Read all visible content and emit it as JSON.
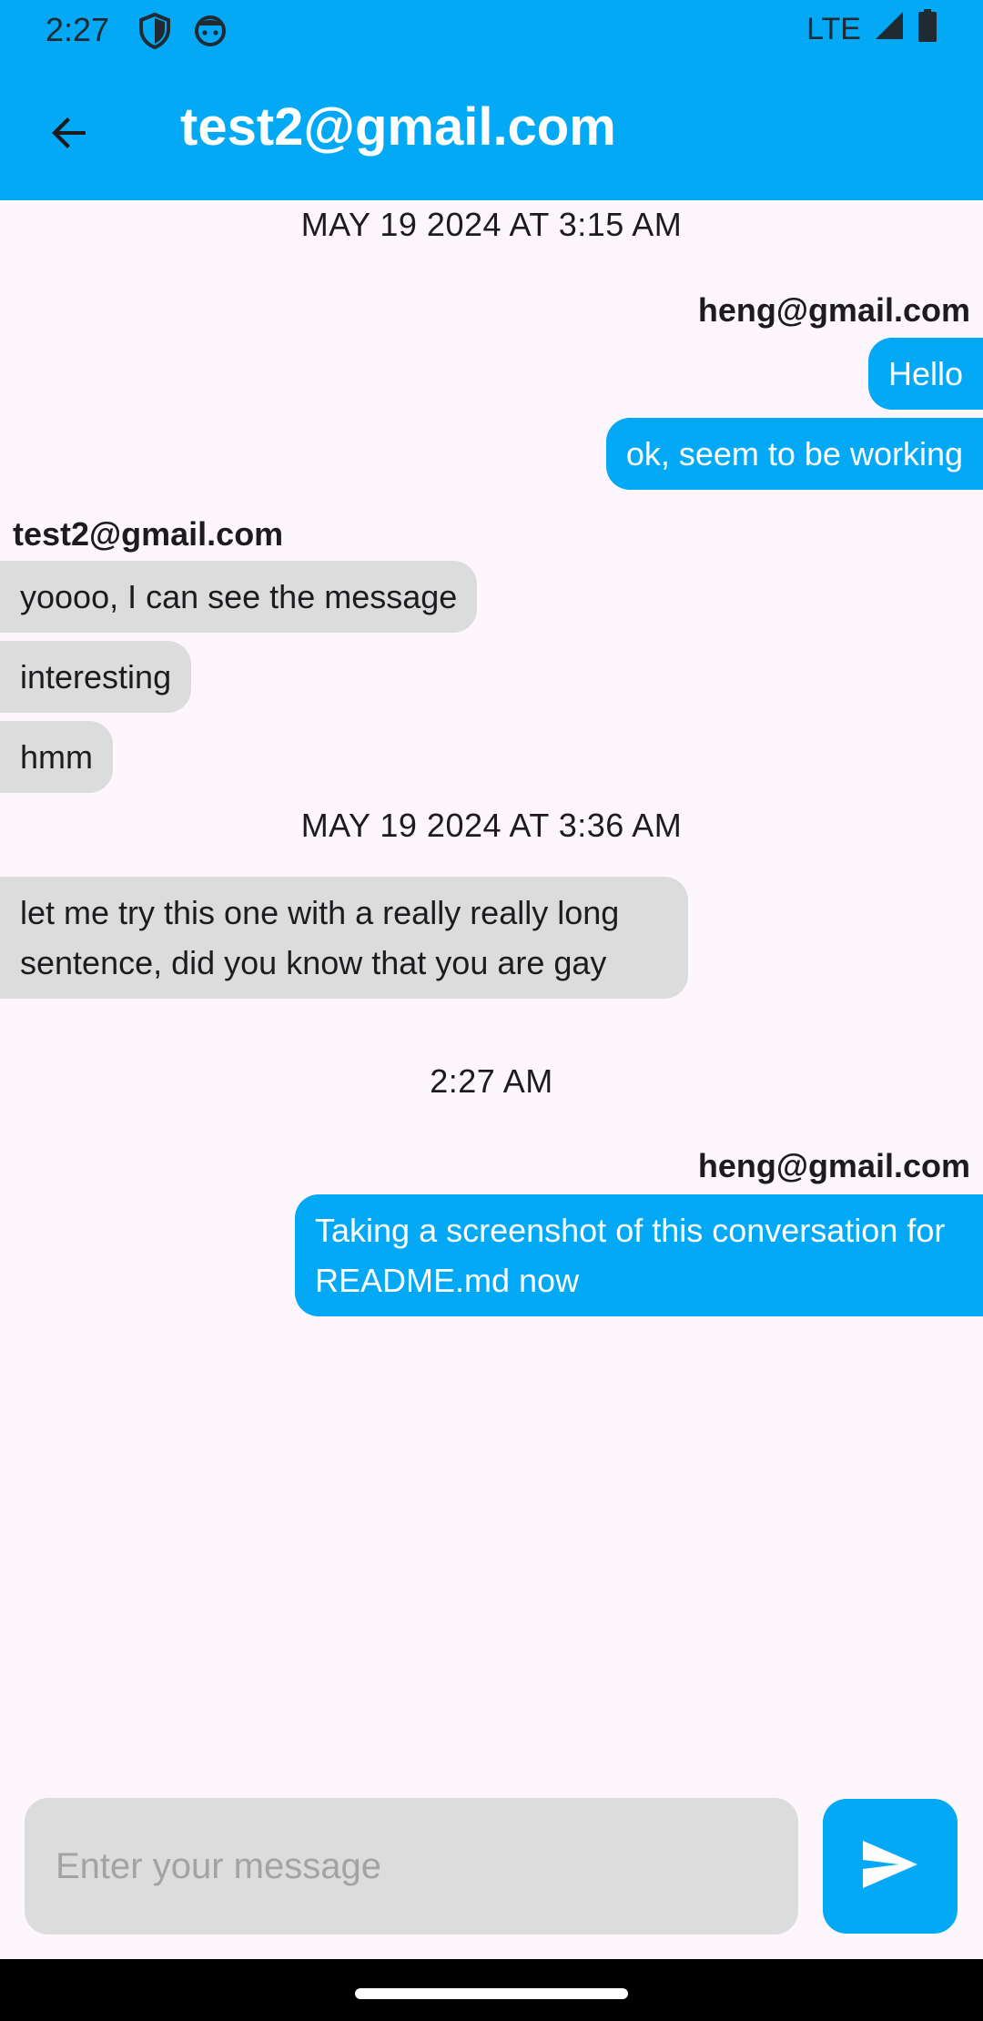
{
  "colors": {
    "accent": "#03a9f4",
    "incoming_bubble": "#dcdcdc",
    "background": "#fdf7fd"
  },
  "status_bar": {
    "time": "2:27",
    "network": "LTE",
    "icons": [
      "shield-icon",
      "face-icon",
      "signal-icon",
      "battery-icon"
    ]
  },
  "app_bar": {
    "back_icon": "arrow-back-icon",
    "title": "test2@gmail.com"
  },
  "chat": {
    "timestamps": [
      "MAY 19 2024 AT 3:15 AM",
      "MAY 19 2024 AT 3:36 AM",
      "2:27 AM"
    ],
    "groups": [
      {
        "sender": "heng@gmail.com",
        "direction": "out",
        "messages": [
          "Hello",
          "ok, seem to be working"
        ]
      },
      {
        "sender": "test2@gmail.com",
        "direction": "in",
        "messages": [
          "yoooo, I can see the message",
          "interesting",
          "hmm"
        ]
      },
      {
        "sender": "",
        "direction": "in",
        "messages": [
          "let me try this one with a really really long sentence, did you know that you are gay"
        ]
      },
      {
        "sender": "heng@gmail.com",
        "direction": "out",
        "messages": [
          "Taking a screenshot of this conversation for README.md now"
        ]
      }
    ]
  },
  "composer": {
    "placeholder": "Enter your message",
    "value": "",
    "send_icon": "send-icon"
  }
}
